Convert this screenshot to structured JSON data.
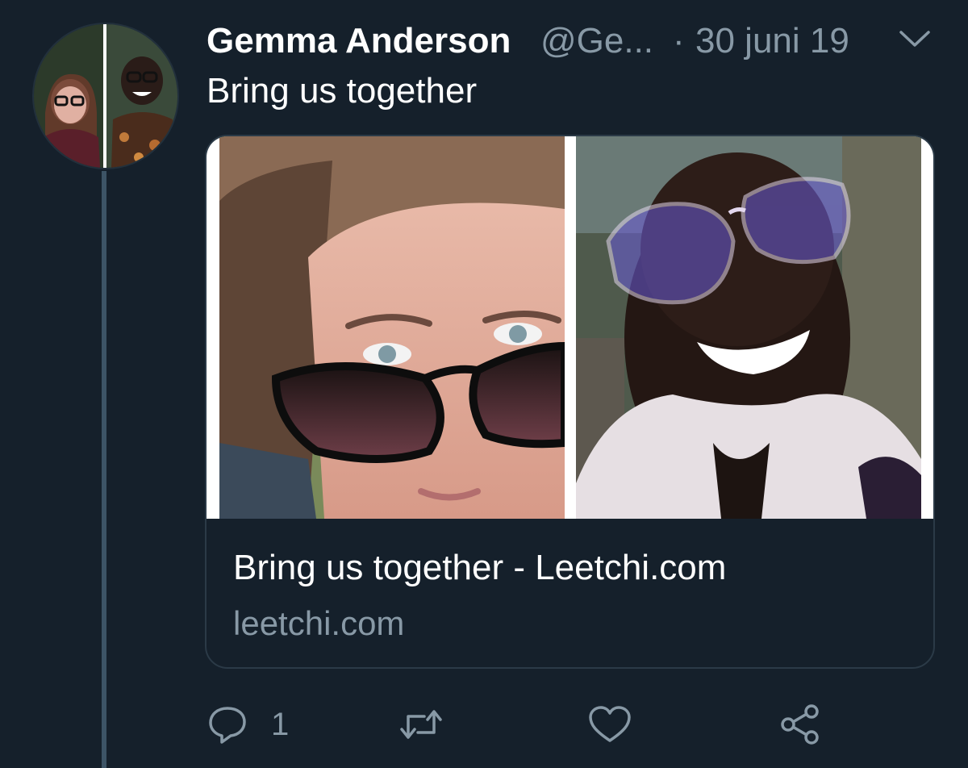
{
  "tweet": {
    "author_name": "Gemma Anderson",
    "author_handle": "@Ge...",
    "separator": "·",
    "date": "30 juni 19",
    "text": "Bring us together"
  },
  "card": {
    "title": "Bring us together - Leetchi.com",
    "domain": "leetchi.com"
  },
  "actions": {
    "reply_count": "1"
  },
  "icons": {
    "reply": "reply-icon",
    "retweet": "retweet-icon",
    "like": "heart-icon",
    "share": "share-icon",
    "menu": "chevron-down-icon"
  },
  "colors": {
    "background": "#15202b",
    "primary_text": "#ffffff",
    "secondary_text": "#8899a6",
    "thread_line": "#3d5466",
    "card_border": "#2b3a47"
  }
}
